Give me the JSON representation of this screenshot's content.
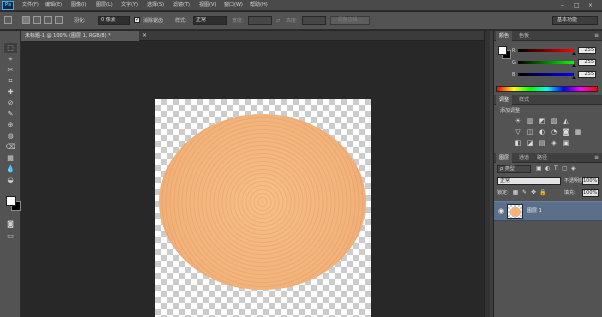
{
  "app": {
    "logo": "Ps"
  },
  "menu": [
    "文件(F)",
    "编辑(E)",
    "图像(I)",
    "图层(L)",
    "文字(Y)",
    "选择(S)",
    "滤镜(T)",
    "视图(V)",
    "窗口(W)",
    "帮助(H)"
  ],
  "window_controls": {
    "minimize": "–",
    "restore": "□",
    "close": "×"
  },
  "options": {
    "feather_label": "羽化:",
    "feather_value": "0 像素",
    "antialias_checked": true,
    "antialias_label": "消除锯齿",
    "style_label": "样式:",
    "style_value": "正常",
    "width_label": "宽度:",
    "height_label": "高度:",
    "refine_edge": "调整边缘...",
    "workspace": "基本功能"
  },
  "document": {
    "tab_title": "未标题-1 @ 100% (图层 1, RGB/8) *",
    "tab_close": "×"
  },
  "color_panel": {
    "tabs": [
      "颜色",
      "色板"
    ],
    "menu_icon": "≡",
    "sliders": [
      {
        "label": "R",
        "value": "255",
        "gradient": "linear-gradient(to right, #000000, #ff0000)"
      },
      {
        "label": "G",
        "value": "255",
        "gradient": "linear-gradient(to right, #000000, #00ff00)"
      },
      {
        "label": "B",
        "value": "255",
        "gradient": "linear-gradient(to right, #000000, #0000ff)"
      }
    ],
    "foreground": "#ffffff",
    "background": "#000000"
  },
  "adjustments_panel": {
    "tabs": [
      "调整",
      "样式"
    ],
    "title": "添加调整",
    "icons_row1": [
      "☀",
      "▥",
      "◩",
      "▨",
      "◭"
    ],
    "icons_row2": [
      "▽",
      "◫",
      "◐",
      "◔",
      "◙",
      "▦"
    ],
    "icons_row3": [
      "◧",
      "◪",
      "▤",
      "◈",
      "▣"
    ]
  },
  "layers_panel": {
    "tabs": [
      "图层",
      "通道",
      "路径"
    ],
    "menu_icon": "≡",
    "filter_label": "ρ 类型",
    "filter_icons": [
      "▣",
      "◐",
      "T",
      "▢",
      "◈"
    ],
    "blend_mode": "正常",
    "opacity_label": "不透明度:",
    "opacity_value": "100%",
    "lock_label": "锁定:",
    "lock_icons": [
      "▦",
      "✎",
      "✥",
      "🔒"
    ],
    "fill_label": "填充:",
    "fill_value": "100%",
    "layers": [
      {
        "name": "图层 1",
        "visible": true,
        "selected": true
      }
    ]
  },
  "tools": [
    "⬚",
    "⌖",
    "✂",
    "⌗",
    "✚",
    "⊘",
    "✎",
    "⊕",
    "◍",
    "⌫",
    "▦",
    "💧",
    "◒",
    "✒",
    "T",
    "↖",
    "▭",
    "✋",
    "🔍"
  ],
  "colors": {
    "shape_fill": "#f3b47c",
    "layer_selected": "#5a6f8a"
  }
}
